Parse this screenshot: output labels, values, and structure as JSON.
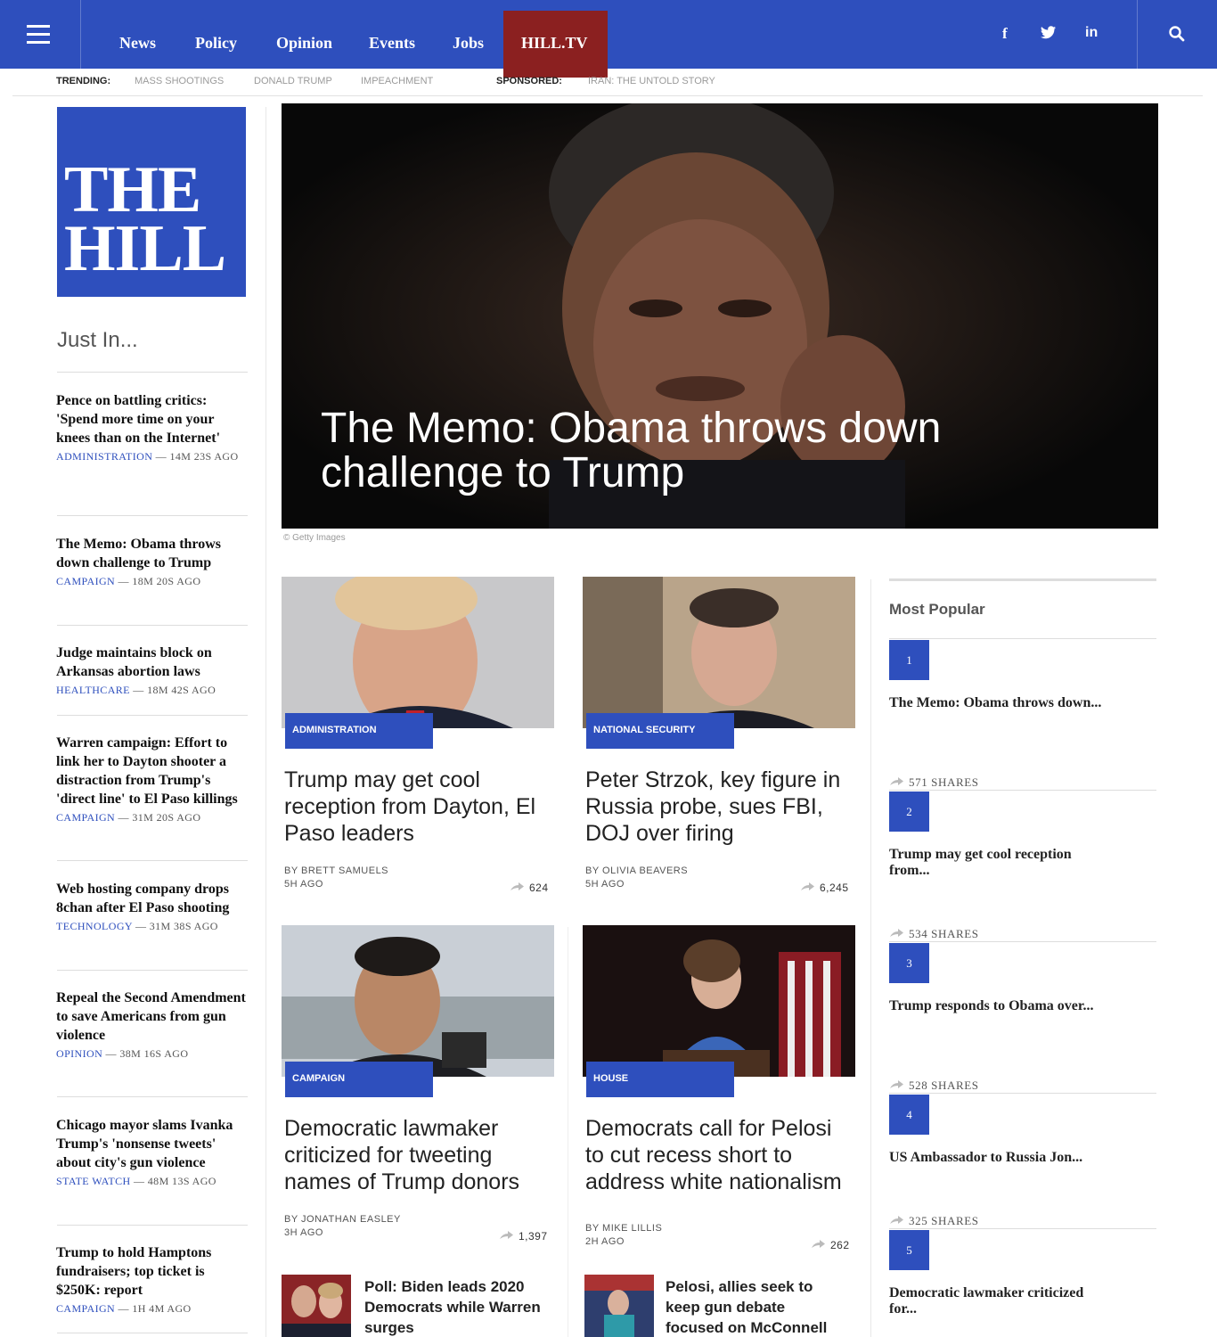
{
  "nav": {
    "links": [
      "News",
      "Policy",
      "Opinion",
      "Events",
      "Jobs"
    ],
    "hilltv": "HILL.TV",
    "social": {
      "facebook": "f",
      "twitter": "t",
      "linkedin": "in"
    }
  },
  "trending": {
    "label": "TRENDING:",
    "items": [
      "MASS SHOOTINGS",
      "DONALD TRUMP",
      "IMPEACHMENT"
    ],
    "sponsored_label": "SPONSORED:",
    "sponsored_item": "IRAN: THE UNTOLD STORY"
  },
  "logo": {
    "line1": "THE",
    "line2": "HILL"
  },
  "just_in": {
    "heading": "Just In...",
    "stories": [
      {
        "title": "Pence on battling critics: 'Spend more time on your knees than on the Internet'",
        "category": "ADMINISTRATION",
        "time": "— 14M 23S AGO"
      },
      {
        "title": "The Memo: Obama throws down challenge to Trump",
        "category": "CAMPAIGN",
        "time": "— 18M 20S AGO"
      },
      {
        "title": "Judge maintains block on Arkansas abortion laws",
        "category": "HEALTHCARE",
        "time": "— 18M 42S AGO"
      },
      {
        "title": "Warren campaign: Effort to link her to Dayton shooter a distraction from Trump's 'direct line' to El Paso killings",
        "category": "CAMPAIGN",
        "time": "— 31M 20S AGO"
      },
      {
        "title": "Web hosting company drops 8chan after El Paso shooting",
        "category": "TECHNOLOGY",
        "time": "— 31M 38S AGO"
      },
      {
        "title": "Repeal the Second Amendment to save Americans from gun violence",
        "category": "OPINION",
        "time": "— 38M 16S AGO"
      },
      {
        "title": "Chicago mayor slams Ivanka Trump's 'nonsense tweets' about city's gun violence",
        "category": "STATE WATCH",
        "time": "— 48M 13S AGO"
      },
      {
        "title": "Trump to hold Hamptons fundraisers; top ticket is $250K: report",
        "category": "CAMPAIGN",
        "time": "— 1H 4M AGO"
      }
    ]
  },
  "hero": {
    "title": "The Memo: Obama throws down challenge to Trump",
    "credit": "© Getty Images"
  },
  "cards": [
    {
      "badge": "ADMINISTRATION",
      "title": "Trump may get cool reception from Dayton, El Paso leaders",
      "byline": "BY BRETT SAMUELS",
      "age": "5H AGO",
      "shares": "624"
    },
    {
      "badge": "NATIONAL SECURITY",
      "title": "Peter Strzok, key figure in Russia probe, sues FBI, DOJ over firing",
      "byline": "BY OLIVIA BEAVERS",
      "age": "5H AGO",
      "shares": "6,245"
    },
    {
      "badge": "CAMPAIGN",
      "title": "Democratic lawmaker criticized for tweeting names of Trump donors",
      "byline": "BY JONATHAN EASLEY",
      "age": "3H AGO",
      "shares": "1,397"
    },
    {
      "badge": "HOUSE",
      "title": "Democrats call for Pelosi to cut recess short to address white nationalism",
      "byline": "BY MIKE LILLIS",
      "age": "2H AGO",
      "shares": "262"
    }
  ],
  "mini_cards": [
    {
      "title": "Poll: Biden leads 2020 Democrats while Warren surges"
    },
    {
      "title": "Pelosi, allies seek to keep gun debate focused on McConnell"
    }
  ],
  "most_popular": {
    "heading": "Most Popular",
    "items": [
      {
        "rank": "1",
        "title": "The Memo: Obama throws down...",
        "shares": "571 SHARES"
      },
      {
        "rank": "2",
        "title": "Trump may get cool reception from...",
        "shares": "534 SHARES"
      },
      {
        "rank": "3",
        "title": "Trump responds to Obama over...",
        "shares": "528 SHARES"
      },
      {
        "rank": "4",
        "title": "US Ambassador to Russia Jon...",
        "shares": "325 SHARES"
      },
      {
        "rank": "5",
        "title": "Democratic lawmaker criticized for..."
      }
    ]
  },
  "colors": {
    "brand_blue": "#2e4fbd",
    "hilltv_red": "#8b2020"
  }
}
